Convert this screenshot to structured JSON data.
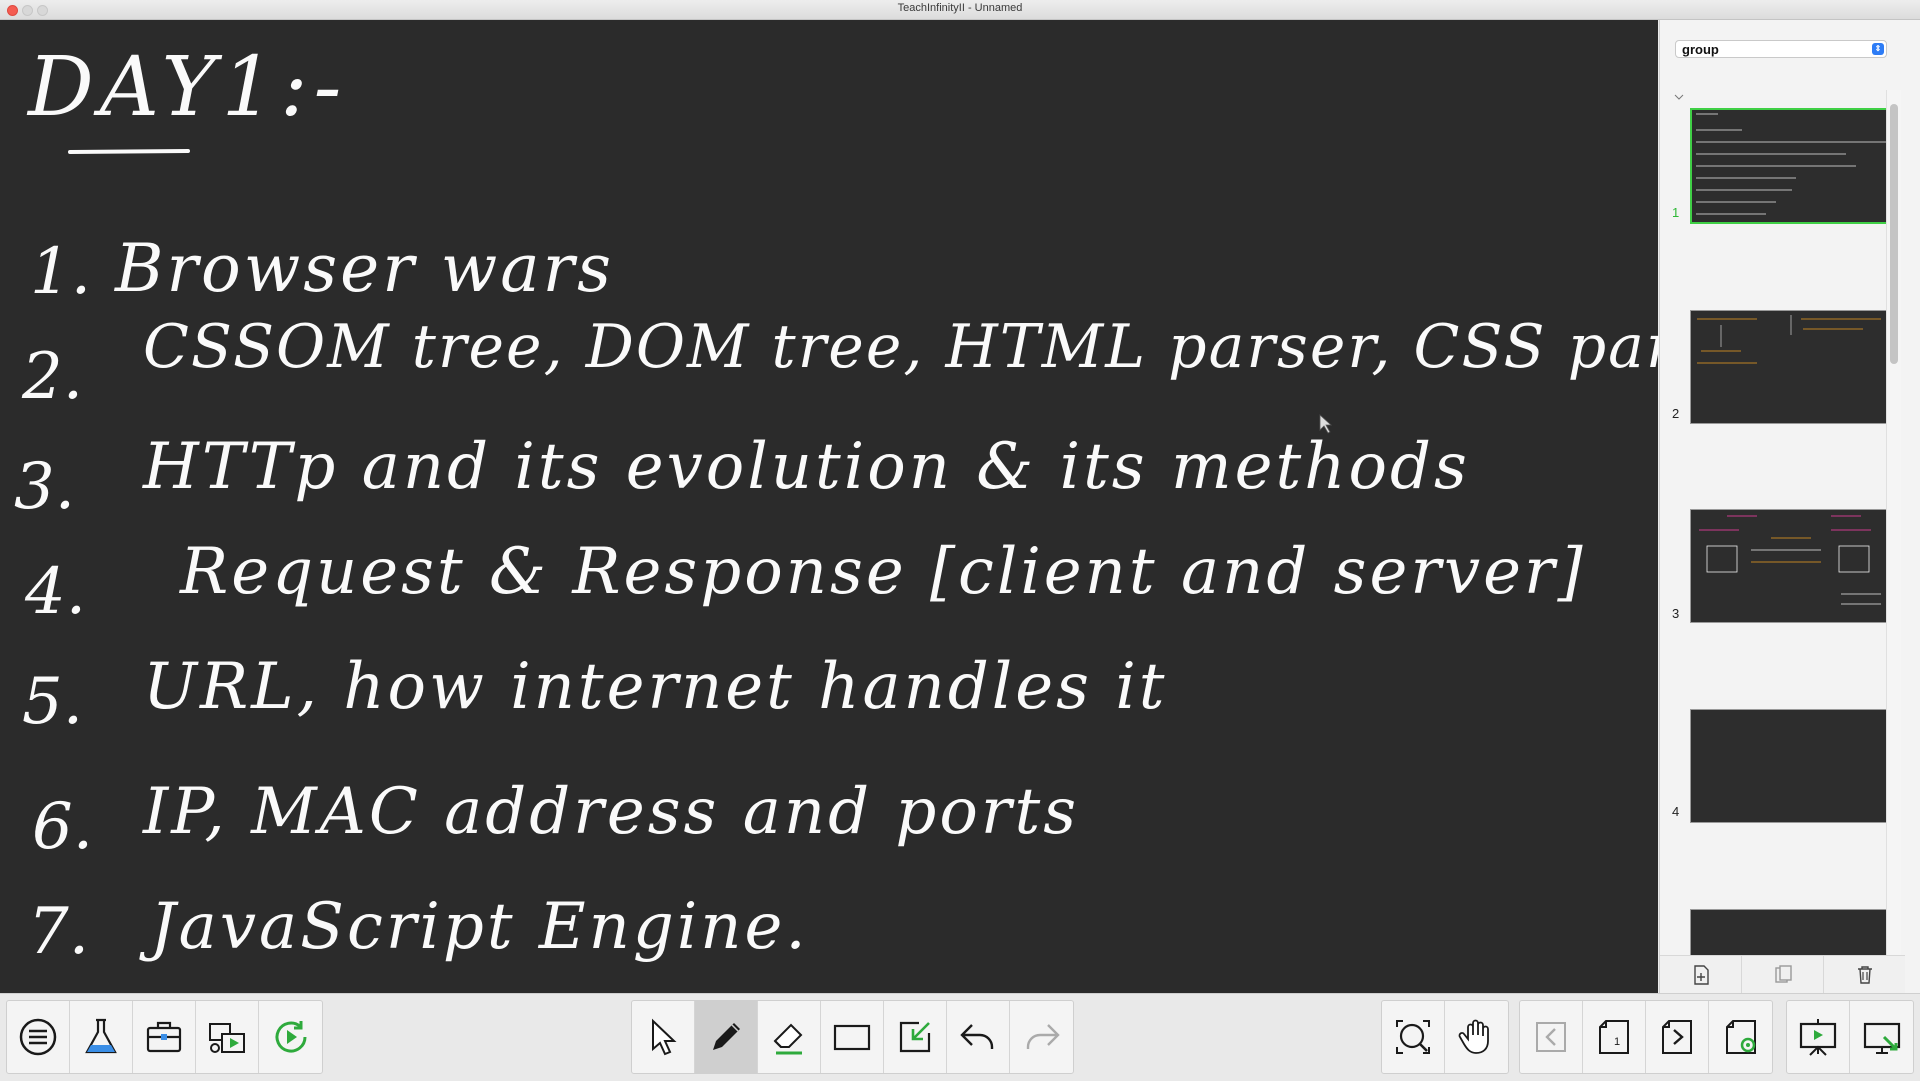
{
  "window": {
    "title": "TeachInfinityII - Unnamed"
  },
  "board": {
    "heading": "DAY1:-",
    "items": [
      {
        "num": "1.",
        "text": "Browser wars"
      },
      {
        "num": "2.",
        "text": "CSSOM tree, DOM tree, HTML parser, CSS parser"
      },
      {
        "num": "3.",
        "text": "HTTp and its evolution & its methods"
      },
      {
        "num": "4.",
        "text": "Request & Response [client and server]"
      },
      {
        "num": "5.",
        "text": "URL, how internet handles it"
      },
      {
        "num": "6.",
        "text": "IP, MAC address and ports"
      },
      {
        "num": "7.",
        "text": "JavaScript Engine."
      }
    ]
  },
  "sidebar": {
    "group_select": "group",
    "pages": [
      {
        "num": "1"
      },
      {
        "num": "2"
      },
      {
        "num": "3"
      },
      {
        "num": "4"
      }
    ]
  },
  "colors": {
    "board": "#2b2b2b",
    "ink": "#fafafa",
    "active_page": "#3fcf45",
    "accent_blue": "#2d7cf6"
  }
}
